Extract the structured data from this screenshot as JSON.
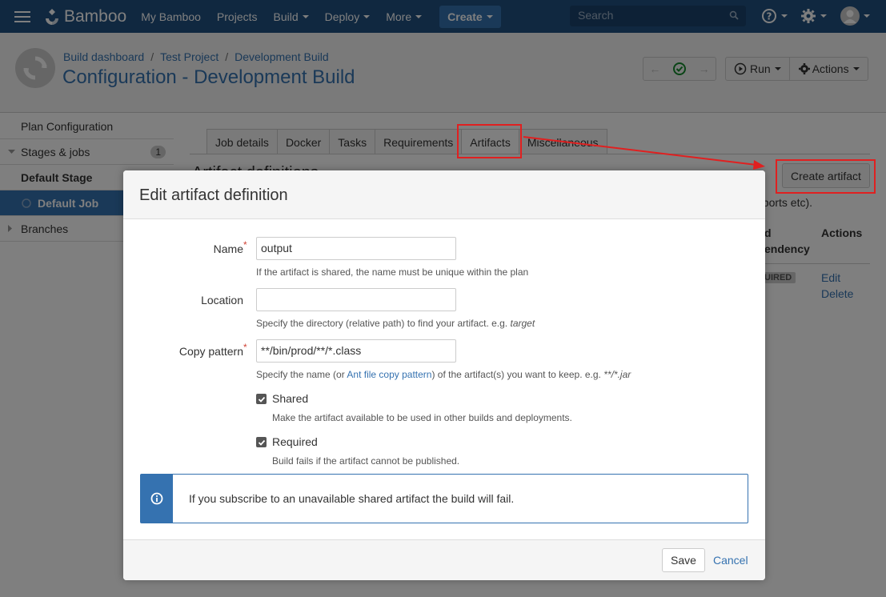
{
  "header": {
    "logo_text": "Bamboo",
    "nav": [
      "My Bamboo",
      "Projects",
      "Build",
      "Deploy",
      "More"
    ],
    "create_label": "Create",
    "search_placeholder": "Search",
    "brand_color": "#205081"
  },
  "plan": {
    "breadcrumb": [
      "Build dashboard",
      "Test Project",
      "Development Build"
    ],
    "title": "Configuration - Development Build",
    "run_label": "Run",
    "actions_label": "Actions"
  },
  "sidebar": {
    "items": [
      {
        "label": "Plan Configuration"
      },
      {
        "label": "Stages & jobs",
        "count": "1"
      },
      {
        "label": "Default Stage"
      },
      {
        "label": "Default Job"
      },
      {
        "label": "Branches"
      }
    ]
  },
  "main": {
    "tabs": [
      "Job details",
      "Docker",
      "Tasks",
      "Requirements",
      "Artifacts",
      "Miscellaneous"
    ],
    "heading": "Artifact definitions",
    "create_artifact_label": "Create artifact",
    "bg_text_reports": "eports etc).",
    "col_dependency_1": "d",
    "col_dependency_2": "endency",
    "col_actions": "Actions",
    "required_badge": "UIRED",
    "edit_link": "Edit",
    "delete_link": "Delete"
  },
  "dialog": {
    "title": "Edit artifact definition",
    "name_label": "Name",
    "name_value": "output",
    "name_help": "If the artifact is shared, the name must be unique within the plan",
    "location_label": "Location",
    "location_value": "",
    "location_help": "Specify the directory (relative path) to find your artifact. e.g.",
    "location_help_example": "target",
    "pattern_label": "Copy pattern",
    "pattern_value": "**/bin/prod/**/*.class",
    "pattern_help_pre": "Specify the name (or",
    "pattern_help_link": "Ant file copy pattern",
    "pattern_help_post": ") of the artifact(s) you want to keep. e.g.",
    "pattern_help_example": "**/*.jar",
    "shared_label": "Shared",
    "shared_checked": true,
    "shared_help": "Make the artifact available to be used in other builds and deployments.",
    "required_label": "Required",
    "required_checked": true,
    "required_help": "Build fails if the artifact cannot be published.",
    "info_text": "If you subscribe to an unavailable shared artifact the build will fail.",
    "save_label": "Save",
    "cancel_label": "Cancel"
  }
}
